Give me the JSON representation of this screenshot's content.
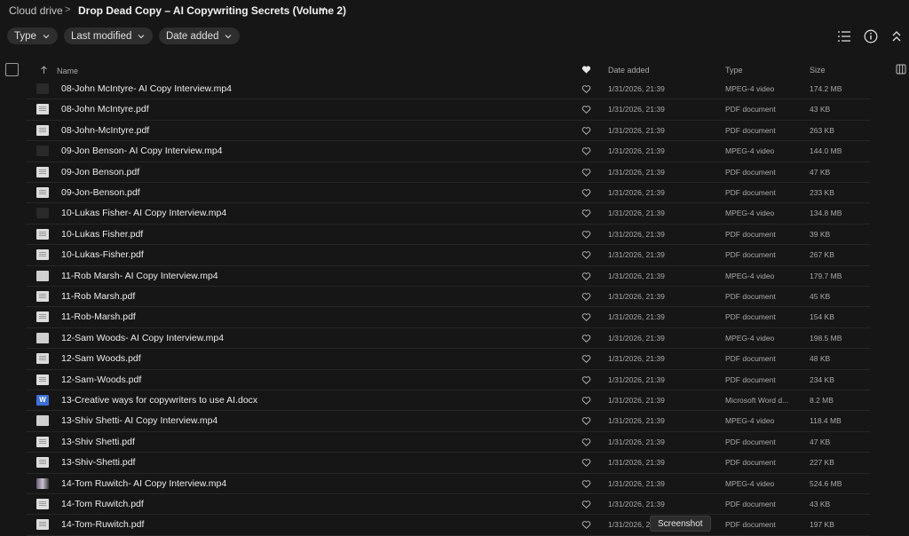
{
  "breadcrumb": {
    "root": "Cloud drive",
    "separator": ">",
    "current": "Drop Dead Copy – AI Copywriting Secrets (Volume 2)"
  },
  "filters": [
    {
      "label": "Type"
    },
    {
      "label": "Last modified"
    },
    {
      "label": "Date added"
    }
  ],
  "toolbar_icons": [
    "list-view-icon",
    "info-icon",
    "collapse-icon"
  ],
  "columns": {
    "name": "Name",
    "date_added": "Date added",
    "type": "Type",
    "size": "Size"
  },
  "rows": [
    {
      "name": "08-John McIntyre- AI Copy Interview.mp4",
      "date": "1/31/2026, 21:39",
      "type": "MPEG-4 video",
      "size": "174.2 MB",
      "thumb": "vid"
    },
    {
      "name": "08-John McIntyre.pdf",
      "date": "1/31/2026, 21:39",
      "type": "PDF document",
      "size": "43 KB",
      "thumb": "pdf"
    },
    {
      "name": "08-John-McIntyre.pdf",
      "date": "1/31/2026, 21:39",
      "type": "PDF document",
      "size": "263 KB",
      "thumb": "pdf"
    },
    {
      "name": "09-Jon Benson- AI Copy Interview.mp4",
      "date": "1/31/2026, 21:39",
      "type": "MPEG-4 video",
      "size": "144.0 MB",
      "thumb": "vid"
    },
    {
      "name": "09-Jon Benson.pdf",
      "date": "1/31/2026, 21:39",
      "type": "PDF document",
      "size": "47 KB",
      "thumb": "pdf"
    },
    {
      "name": "09-Jon-Benson.pdf",
      "date": "1/31/2026, 21:39",
      "type": "PDF document",
      "size": "233 KB",
      "thumb": "pdf"
    },
    {
      "name": "10-Lukas Fisher- AI Copy Interview.mp4",
      "date": "1/31/2026, 21:39",
      "type": "MPEG-4 video",
      "size": "134.8 MB",
      "thumb": "vid"
    },
    {
      "name": "10-Lukas Fisher.pdf",
      "date": "1/31/2026, 21:39",
      "type": "PDF document",
      "size": "39 KB",
      "thumb": "pdf"
    },
    {
      "name": "10-Lukas-Fisher.pdf",
      "date": "1/31/2026, 21:39",
      "type": "PDF document",
      "size": "267 KB",
      "thumb": "pdf"
    },
    {
      "name": "11-Rob Marsh- AI Copy Interview.mp4",
      "date": "1/31/2026, 21:39",
      "type": "MPEG-4 video",
      "size": "179.7 MB",
      "thumb": "vid-light"
    },
    {
      "name": "11-Rob Marsh.pdf",
      "date": "1/31/2026, 21:39",
      "type": "PDF document",
      "size": "45 KB",
      "thumb": "pdf"
    },
    {
      "name": "11-Rob-Marsh.pdf",
      "date": "1/31/2026, 21:39",
      "type": "PDF document",
      "size": "154 KB",
      "thumb": "pdf"
    },
    {
      "name": "12-Sam Woods- AI Copy Interview.mp4",
      "date": "1/31/2026, 21:39",
      "type": "MPEG-4 video",
      "size": "198.5 MB",
      "thumb": "vid-light"
    },
    {
      "name": "12-Sam Woods.pdf",
      "date": "1/31/2026, 21:39",
      "type": "PDF document",
      "size": "48 KB",
      "thumb": "pdf"
    },
    {
      "name": "12-Sam-Woods.pdf",
      "date": "1/31/2026, 21:39",
      "type": "PDF document",
      "size": "234 KB",
      "thumb": "pdf"
    },
    {
      "name": "13-Creative ways for copywriters to use AI.docx",
      "date": "1/31/2026, 21:39",
      "type": "Microsoft Word d...",
      "size": "8.2 MB",
      "thumb": "doc"
    },
    {
      "name": "13-Shiv Shetti- AI Copy Interview.mp4",
      "date": "1/31/2026, 21:39",
      "type": "MPEG-4 video",
      "size": "118.4 MB",
      "thumb": "vid-light"
    },
    {
      "name": "13-Shiv Shetti.pdf",
      "date": "1/31/2026, 21:39",
      "type": "PDF document",
      "size": "47 KB",
      "thumb": "pdf"
    },
    {
      "name": "13-Shiv-Shetti.pdf",
      "date": "1/31/2026, 21:39",
      "type": "PDF document",
      "size": "227 KB",
      "thumb": "pdf"
    },
    {
      "name": "14-Tom Ruwitch- AI Copy Interview.mp4",
      "date": "1/31/2026, 21:39",
      "type": "MPEG-4 video",
      "size": "524.6 MB",
      "thumb": "vid-color"
    },
    {
      "name": "14-Tom Ruwitch.pdf",
      "date": "1/31/2026, 21:39",
      "type": "PDF document",
      "size": "43 KB",
      "thumb": "pdf"
    },
    {
      "name": "14-Tom-Ruwitch.pdf",
      "date": "1/31/2026, 21:39",
      "type": "PDF document",
      "size": "197 KB",
      "thumb": "pdf"
    }
  ],
  "doc_icon_letter": "W",
  "tooltip": "Screenshot"
}
